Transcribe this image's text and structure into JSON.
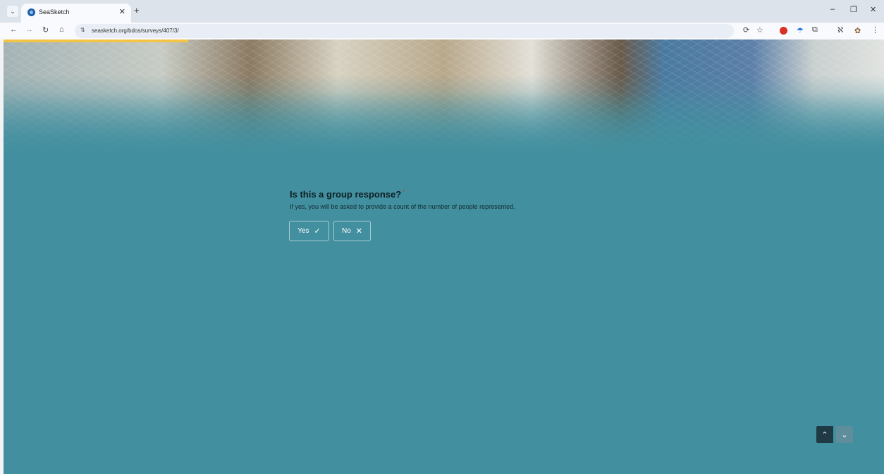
{
  "browser": {
    "tab_title": "SeaSketch",
    "url": "seasketch.org/bdos/surveys/407/3/",
    "icons": {
      "tab_search": "chevron-down-icon",
      "tab_close": "close-icon",
      "new_tab": "plus-icon",
      "back": "arrow-left-icon",
      "forward": "arrow-right-icon",
      "reload": "reload-icon",
      "home": "home-icon",
      "site_info": "tune-icon",
      "translate": "translate-icon",
      "bookmark": "star-icon",
      "extensions": "puzzle-icon",
      "menu": "kebab-icon"
    },
    "glyphs": {
      "tab_search": "⌄",
      "tab_close": "✕",
      "new_tab": "+",
      "back": "←",
      "forward": "→",
      "reload": "↻",
      "home": "⌂",
      "site_info": "⇅",
      "translate": "⟳",
      "bookmark": "☆",
      "ext_blue": "☂",
      "puzzle": "⧉",
      "ext_9": "ℵ",
      "ext_brown": "✿",
      "menu": "⋮",
      "minimize": "–",
      "restore": "❐",
      "close": "✕"
    }
  },
  "survey": {
    "progress_fraction": 0.21,
    "question": {
      "title": "Is this a group response?",
      "required_mark": "*",
      "description": "If yes, you will be asked to provide a count of the number of people represented."
    },
    "options": [
      {
        "label": "Yes",
        "glyph": "✓",
        "icon": "check-icon"
      },
      {
        "label": "No",
        "glyph": "✕",
        "icon": "close-icon"
      }
    ],
    "nav": {
      "up_glyph": "⌃",
      "down_glyph": "⌄"
    }
  },
  "colors": {
    "page_background": "#428f9f",
    "progress_bar": "#f3c447",
    "nav_up": "#1f3a45",
    "nav_down": "#5e8e9b"
  }
}
